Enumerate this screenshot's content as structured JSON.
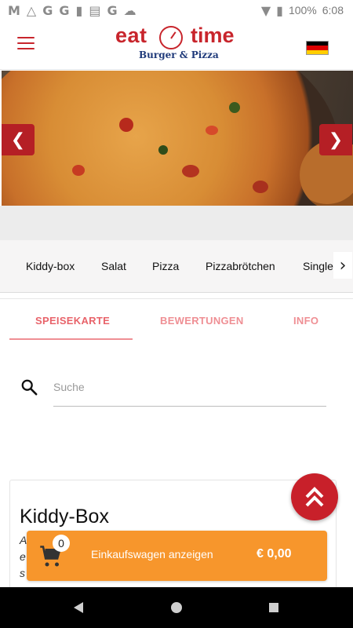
{
  "status_bar": {
    "battery": "100%",
    "time": "6:08",
    "icons": [
      "gmail-icon",
      "drive-icon",
      "google-icon",
      "google-icon",
      "sd-card-icon",
      "news-icon",
      "google-icon",
      "cloud-icon",
      "wifi-icon",
      "battery-icon"
    ]
  },
  "header": {
    "logo_word1": "eat",
    "logo_word2": "time",
    "logo_tagline": "Burger & Pizza",
    "language_flag": "germany-flag"
  },
  "categories": [
    "Kiddy-box",
    "Salat",
    "Pizza",
    "Pizzabrötchen",
    "Single m"
  ],
  "tabs": [
    {
      "label": "SPEISEKARTE",
      "active": true
    },
    {
      "label": "BEWERTUNGEN",
      "active": false
    },
    {
      "label": "INFO",
      "active": false
    }
  ],
  "search": {
    "placeholder": "Suche",
    "value": ""
  },
  "section": {
    "title": "Kiddy-Box",
    "desc_lines": [
      "A",
      "e",
      "s"
    ]
  },
  "cart": {
    "count": "0",
    "label": "Einkaufswagen anzeigen",
    "total": "€ 0,00"
  },
  "colors": {
    "brand_red": "#c8252c",
    "tab_accent": "#e8636a",
    "cart_orange": "#f7962c"
  }
}
